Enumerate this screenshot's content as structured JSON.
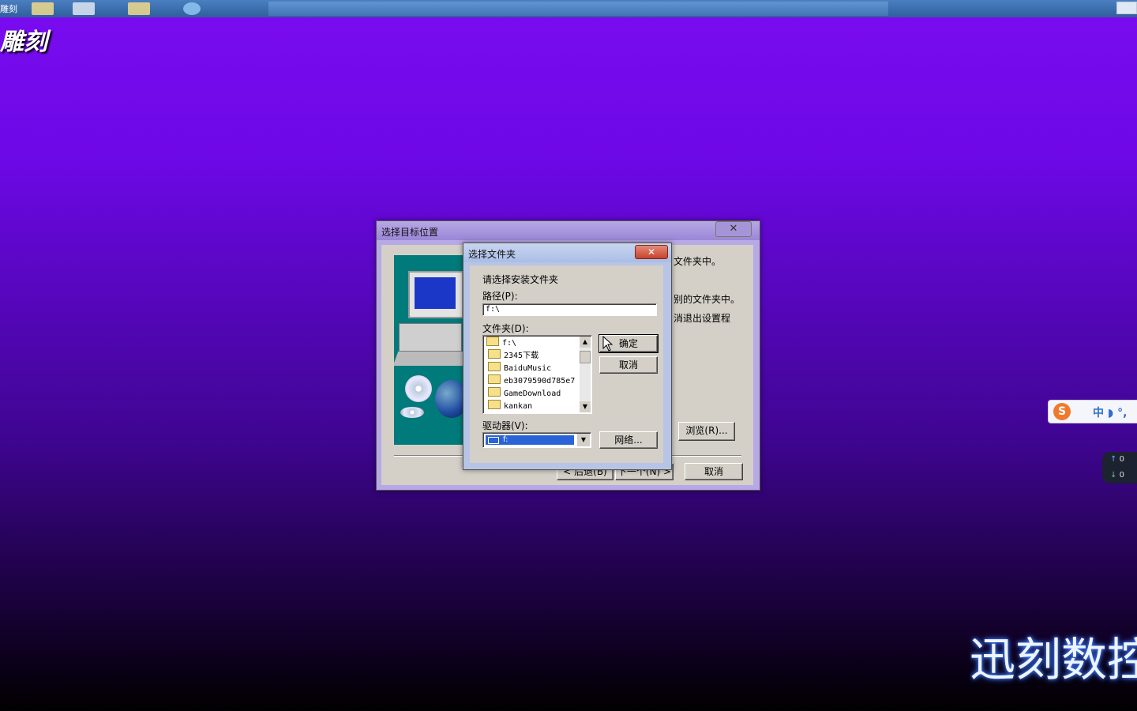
{
  "taskbar": {
    "title": "雕刻"
  },
  "desktop": {
    "brand": "雕刻",
    "bottom_brand": "迅刻数控"
  },
  "setup_window": {
    "title": "选择目标位置",
    "close_label": "✕",
    "text_line1": "文件夹中。",
    "text_line2": "别的文件夹中。",
    "text_line3": "消退出设置程",
    "browse_label": "浏览(R)...",
    "back_label": "< 后退(B)",
    "next_label": "下一个(N) >",
    "cancel_label": "取消"
  },
  "folder_dialog": {
    "title": "选择文件夹",
    "close_label": "✕",
    "prompt": "请选择安装文件夹",
    "path_label": "路径(P):",
    "path_value": "f:\\",
    "folders_label": "文件夹(D):",
    "folders": [
      {
        "name": "f:\\",
        "open": true
      },
      {
        "name": "2345下载"
      },
      {
        "name": "BaiduMusic"
      },
      {
        "name": "eb3079590d785e7"
      },
      {
        "name": "GameDownload"
      },
      {
        "name": "kankan"
      }
    ],
    "ok_label": "确定",
    "cancel_label": "取消",
    "drive_label": "驱动器(V):",
    "drive_value": "f:",
    "network_label": "网络..."
  },
  "ime": {
    "text": "中 ◗ °,"
  },
  "netmon": {
    "up": "0",
    "down": "0"
  },
  "colors": {
    "titlebar_setup": "#b7a8e6",
    "titlebar_dialog": "#c9d6f0",
    "selection": "#2a63d8",
    "desktop_top": "#7a0cf0"
  }
}
